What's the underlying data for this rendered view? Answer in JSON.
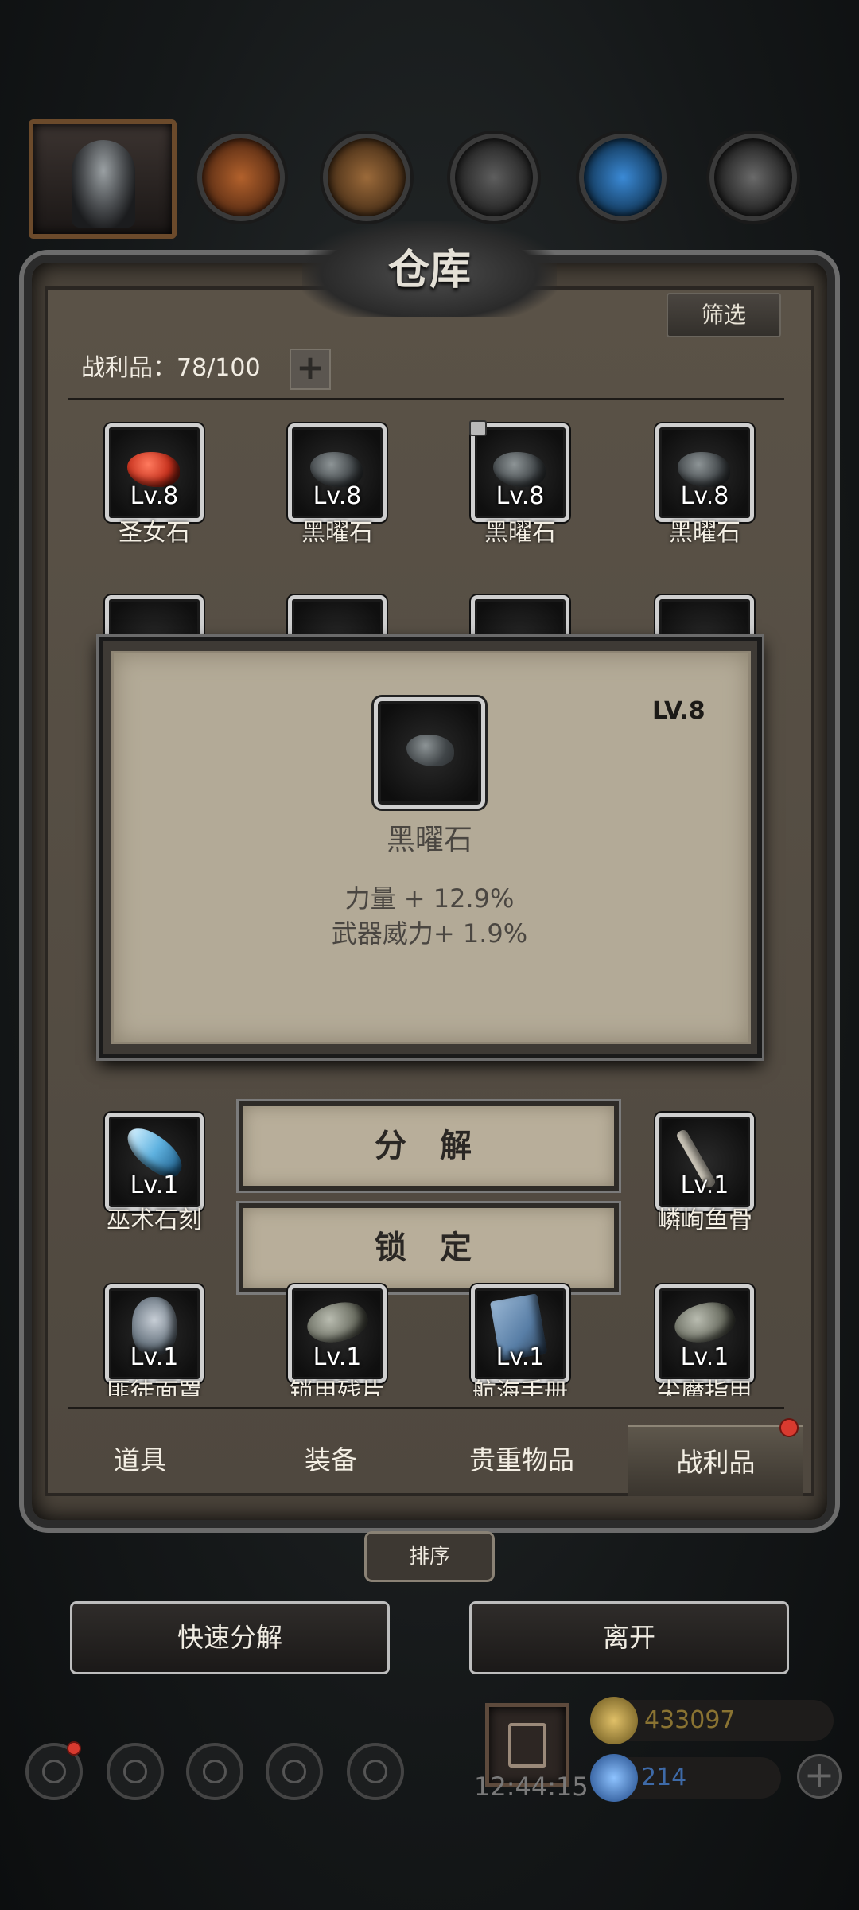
{
  "header": {
    "title": "仓库",
    "filter_label": "筛选",
    "resources": [
      {
        "icon": "copper-ore-icon",
        "color": "#b2612c"
      },
      {
        "icon": "wood-plank-icon",
        "color": "#9b6a3a"
      },
      {
        "icon": "iron-ingot-icon",
        "color": "#6a6a6a"
      },
      {
        "icon": "crystal-icon",
        "color": "#3b8ad6"
      },
      {
        "icon": "steel-ingot-icon",
        "color": "#7a7a7a"
      }
    ]
  },
  "loot": {
    "count_label": "战利品：78/100",
    "add_icon": "plus-icon"
  },
  "grid": {
    "row1": [
      {
        "level": "Lv.8",
        "name": "圣女石",
        "gem_color": "#c8321e",
        "locked": false
      },
      {
        "level": "Lv.8",
        "name": "黑曜石",
        "gem_color": "#4b5053",
        "locked": false
      },
      {
        "level": "Lv.8",
        "name": "黑曜石",
        "gem_color": "#4b5053",
        "locked": true
      },
      {
        "level": "Lv.8",
        "name": "黑曜石",
        "gem_color": "#4b5053",
        "locked": false
      }
    ],
    "row4": [
      {
        "level": "Lv.1",
        "name": "巫术石刻",
        "gem_color": "#5fb2e0"
      },
      {
        "level": "Lv.1",
        "name": "嶙峋鱼骨",
        "gem_color": "#c9c2b5"
      }
    ],
    "row5": [
      {
        "level": "Lv.1",
        "name": "匪徒面罩",
        "gem_color": "#8b98a6"
      },
      {
        "level": "Lv.1",
        "name": "锁甲残片",
        "gem_color": "#7a7d70"
      },
      {
        "level": "Lv.1",
        "name": "航海手册",
        "gem_color": "#587ea6"
      },
      {
        "level": "Lv.1",
        "name": "尖魔指甲",
        "gem_color": "#7a7d70"
      }
    ]
  },
  "tooltip": {
    "level": "LV.8",
    "name": "黑曜石",
    "stat1": "力量 + 12.9%",
    "stat2": "武器威力+ 1.9%"
  },
  "actions": {
    "decompose": "分 解",
    "lock": "锁 定"
  },
  "tabs": [
    "道具",
    "装备",
    "贵重物品",
    "战利品"
  ],
  "active_tab": 3,
  "sort_label": "排序",
  "bottom": {
    "quick_decompose": "快速分解",
    "leave": "离开"
  },
  "footer": {
    "time": "12:44:15",
    "gold": "433097",
    "gems": "214",
    "gold_color": "#8a7332",
    "gem_color": "#3e6aa8"
  }
}
